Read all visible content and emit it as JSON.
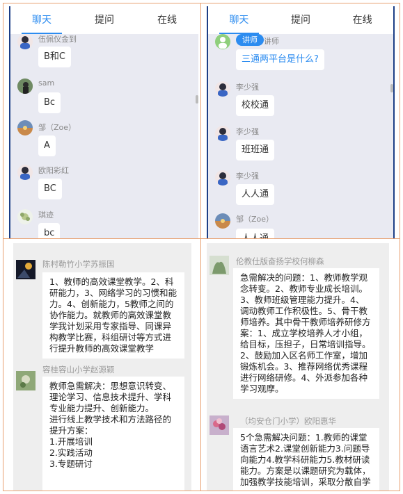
{
  "tabs": [
    "聊天",
    "提问",
    "在线"
  ],
  "panel1": {
    "messages": [
      {
        "name": "伍佩仪金到",
        "text": "B和C"
      },
      {
        "name": "sam",
        "text": "Bc"
      },
      {
        "name": "邹（Zoe）",
        "text": "A"
      },
      {
        "name": "欧阳彩红",
        "text": "BC"
      },
      {
        "name": "琪迹",
        "text": "bc"
      }
    ]
  },
  "panel2": {
    "lecturer_badge": "讲师",
    "lecturer_name": "讲师",
    "lecturer_question": "三通两平台是什么?",
    "messages": [
      {
        "name": "李少强",
        "text": "校校通"
      },
      {
        "name": "李少强",
        "text": "班班通"
      },
      {
        "name": "李少强",
        "text": "人人通"
      },
      {
        "name": "邹（Zoe）",
        "text": "人人通"
      }
    ]
  },
  "panel3": {
    "posts": [
      {
        "name": "陈村勒竹小学苏振国",
        "text": "1、教师的高效课堂教学。2、科研能力，3、网络学习的习惯和能力。4、创新能力，5教师之间的协作能力。就教师的高效课堂教学我计划采用专家指导、同课异构教学比赛，科组研讨等方式进行提升教师的高效课堂教学"
      },
      {
        "name": "容桂容山小学赵源颖",
        "text": "教师急需解决：思想意识转变、理论学习、信息技术提升、学科专业能力提升、创新能力。\n进行线上教学技术和方法路径的提升方案：\n1.开展培训\n2.实践活动\n3.专题研讨"
      }
    ]
  },
  "panel4": {
    "posts": [
      {
        "name": "伦教仕版奋扬学校何柳森",
        "text": "急需解决的问题：1、教师教学观念转变。2、教师专业成长培训。3、教师班级管理能力提升。4、调动教师工作积极性。5、骨干教师培养。其中骨干教师培养研修方案：1、成立学校培养人才小组，给目标，压担子，日常培训指导。2、鼓励加入区名师工作室，增加锻炼机会。3、推荐网络优秀课程进行网络研修。4、外派参加各种学习观摩。"
      },
      {
        "name": "（均安仓门小学）欧阳惠华",
        "text": "5个急需解决问题：1.教师的课堂语言艺术2.课堂创新能力3.问题导向能力4.教学科研能力5.教材研读能力。方案是以课题研究为载体，加强教学技能培训，采取分散自学"
      }
    ]
  },
  "colors": {
    "accent": "#2c8cf0",
    "phone_bg": "#e9eaf2",
    "frame": "#1c3e86",
    "grid": "#e8a070"
  }
}
